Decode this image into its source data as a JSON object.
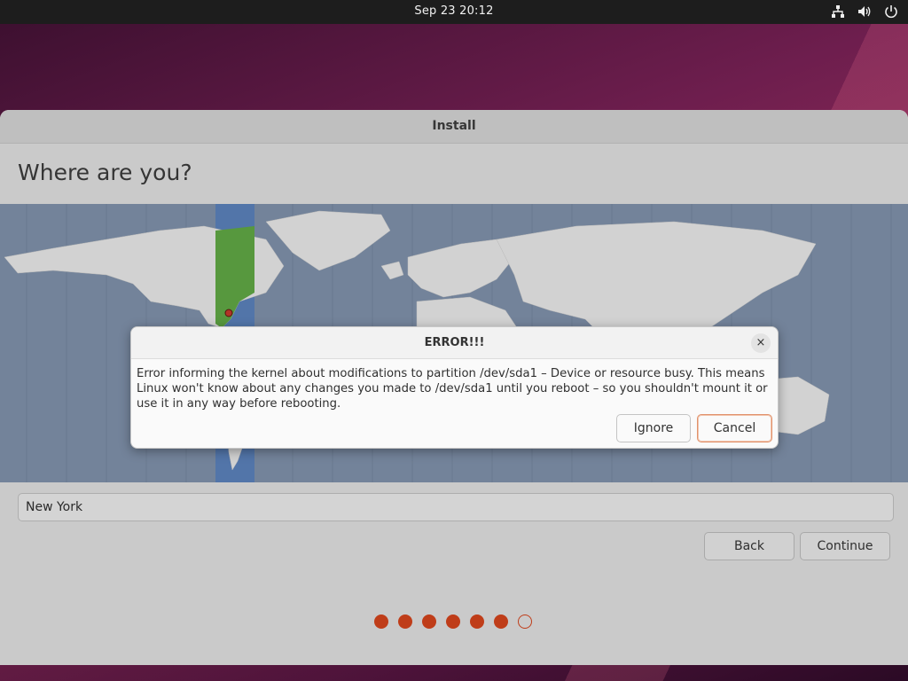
{
  "topbar": {
    "clock": "Sep 23  20:12",
    "icons": [
      "network-icon",
      "volume-icon",
      "power-icon"
    ]
  },
  "window": {
    "title": "Install",
    "heading": "Where are you?",
    "location_value": "New York",
    "back_label": "Back",
    "continue_label": "Continue",
    "progress": {
      "total": 7,
      "completed": 6
    }
  },
  "dialog": {
    "title": "ERROR!!!",
    "message": "Error informing the kernel about modifications to partition /dev/sda1 – Device or resource busy. This means Linux won't know about any changes you made to /dev/sda1 until you reboot – so you shouldn't mount it or use it in any way before rebooting.",
    "close_glyph": "×",
    "ignore_label": "Ignore",
    "cancel_label": "Cancel"
  },
  "colors": {
    "accent": "#d0431c",
    "timezone_highlight": "#5fa544",
    "ocean": "#7d8fa8"
  }
}
